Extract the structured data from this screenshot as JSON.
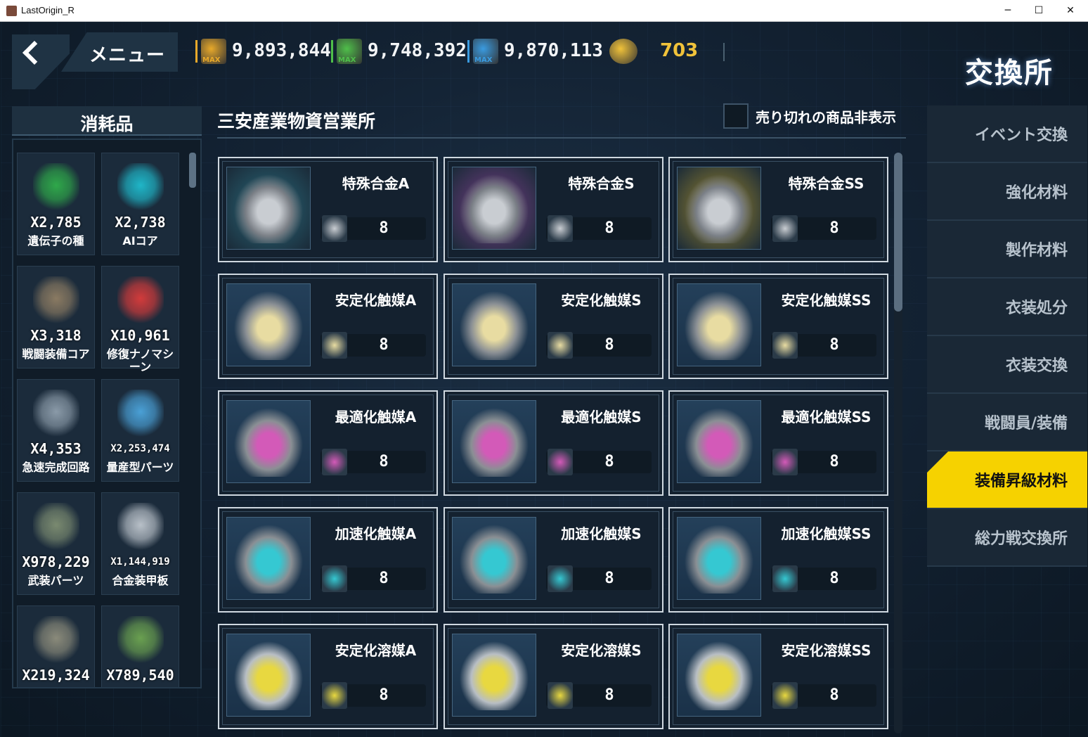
{
  "window": {
    "title": "LastOrigin_R",
    "minimize": "─",
    "maximize": "☐",
    "close": "✕"
  },
  "header": {
    "menu_label": "メニュー",
    "page_title": "交換所",
    "resources": [
      {
        "icon": "parts-max-icon",
        "badge": "MAX",
        "value": "9,893,844",
        "color": "#e8a92a"
      },
      {
        "icon": "nutrient-max-icon",
        "badge": "MAX",
        "value": "9,748,392",
        "color": "#4fbf4a"
      },
      {
        "icon": "power-max-icon",
        "badge": "MAX",
        "value": "9,870,113",
        "color": "#3a9be0"
      },
      {
        "icon": "tuna-can-icon",
        "badge": "",
        "value": "703",
        "color": "#f0c23a"
      }
    ]
  },
  "left_panel": {
    "title": "消耗品",
    "items": [
      {
        "count": "X2,785",
        "name": "遺伝子の種",
        "icon": "gene-seed-icon"
      },
      {
        "count": "X2,738",
        "name": "AIコア",
        "icon": "ai-core-icon"
      },
      {
        "count": "X3,318",
        "name": "戦闘装備コア",
        "icon": "combat-equip-core-icon"
      },
      {
        "count": "X10,961",
        "name": "修復ナノマシーン",
        "icon": "repair-nanomachine-icon"
      },
      {
        "count": "X4,353",
        "name": "急速完成回路",
        "icon": "quick-complete-circuit-icon"
      },
      {
        "count": "X2,253,474",
        "name": "量産型パーツ",
        "icon": "mass-production-parts-icon"
      },
      {
        "count": "X978,229",
        "name": "武装パーツ",
        "icon": "armament-parts-icon"
      },
      {
        "count": "X1,144,919",
        "name": "合金装甲板",
        "icon": "alloy-armor-plate-icon"
      },
      {
        "count": "X219,324",
        "name": "",
        "icon": "weapon-parts-icon"
      },
      {
        "count": "X789,540",
        "name": "",
        "icon": "chip-icon"
      }
    ]
  },
  "shop": {
    "title": "三安産業物資営業所",
    "hide_sold_out_label": "売り切れの商品非表示",
    "items": [
      {
        "name": "特殊合金A",
        "cost": "8",
        "icon": "special-alloy-a-icon",
        "bg": "#2a6b7c"
      },
      {
        "name": "特殊合金S",
        "cost": "8",
        "icon": "special-alloy-s-icon",
        "bg": "#7b3f8a"
      },
      {
        "name": "特殊合金SS",
        "cost": "8",
        "icon": "special-alloy-ss-icon",
        "bg": "#a08a2c"
      },
      {
        "name": "安定化触媒A",
        "cost": "8",
        "icon": "stabilizing-catalyst-a-icon",
        "bg": "#2e4f68"
      },
      {
        "name": "安定化触媒S",
        "cost": "8",
        "icon": "stabilizing-catalyst-s-icon",
        "bg": "#2e4f68"
      },
      {
        "name": "安定化触媒SS",
        "cost": "8",
        "icon": "stabilizing-catalyst-ss-icon",
        "bg": "#2e4f68"
      },
      {
        "name": "最適化触媒A",
        "cost": "8",
        "icon": "optimizing-catalyst-a-icon",
        "bg": "#2e4f68"
      },
      {
        "name": "最適化触媒S",
        "cost": "8",
        "icon": "optimizing-catalyst-s-icon",
        "bg": "#2e4f68"
      },
      {
        "name": "最適化触媒SS",
        "cost": "8",
        "icon": "optimizing-catalyst-ss-icon",
        "bg": "#2e4f68"
      },
      {
        "name": "加速化触媒A",
        "cost": "8",
        "icon": "accelerating-catalyst-a-icon",
        "bg": "#2e4f68"
      },
      {
        "name": "加速化触媒S",
        "cost": "8",
        "icon": "accelerating-catalyst-s-icon",
        "bg": "#2e4f68"
      },
      {
        "name": "加速化触媒SS",
        "cost": "8",
        "icon": "accelerating-catalyst-ss-icon",
        "bg": "#2e4f68"
      },
      {
        "name": "安定化溶媒A",
        "cost": "8",
        "icon": "stabilizing-solvent-a-icon",
        "bg": "#2e4f68"
      },
      {
        "name": "安定化溶媒S",
        "cost": "8",
        "icon": "stabilizing-solvent-s-icon",
        "bg": "#2e4f68"
      },
      {
        "name": "安定化溶媒SS",
        "cost": "8",
        "icon": "stabilizing-solvent-ss-icon",
        "bg": "#2e4f68"
      }
    ]
  },
  "tabs": [
    {
      "label": "イベント交換",
      "active": false
    },
    {
      "label": "強化材料",
      "active": false
    },
    {
      "label": "製作材料",
      "active": false
    },
    {
      "label": "衣装処分",
      "active": false
    },
    {
      "label": "衣装交換",
      "active": false
    },
    {
      "label": "戦闘員/装備",
      "active": false
    },
    {
      "label": "装備昇級材料",
      "active": true
    },
    {
      "label": "総力戦交換所",
      "active": false
    }
  ]
}
